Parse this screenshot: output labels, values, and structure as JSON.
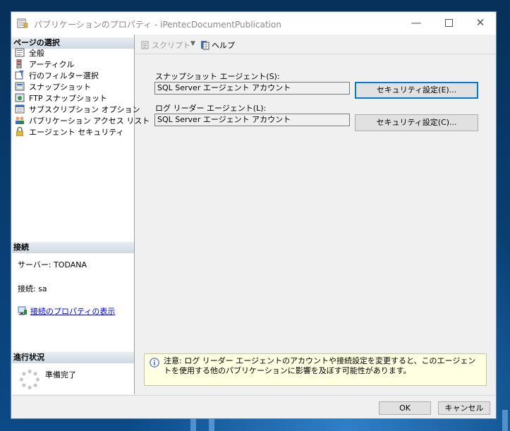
{
  "window": {
    "title": "パブリケーションのプロパティ - iPentecDocumentPublication",
    "minimize_icon": "minimize-icon",
    "maximize_icon": "maximize-icon",
    "close_glyph": "✕"
  },
  "left": {
    "select_page_header": "ページの選択",
    "pages": [
      {
        "label": "全般",
        "icon": "general-page-icon"
      },
      {
        "label": "アーティクル",
        "icon": "articles-page-icon"
      },
      {
        "label": "行のフィルター選択",
        "icon": "filter-rows-page-icon"
      },
      {
        "label": "スナップショット",
        "icon": "snapshot-page-icon"
      },
      {
        "label": "FTP スナップショット",
        "icon": "ftp-snapshot-page-icon"
      },
      {
        "label": "サブスクリプション オプション",
        "icon": "subscription-options-page-icon"
      },
      {
        "label": "パブリケーション アクセス リスト",
        "icon": "access-list-page-icon"
      },
      {
        "label": "エージェント セキュリティ",
        "icon": "agent-security-page-icon"
      }
    ],
    "connection_header": "接続",
    "server_text": "サーバー: TODANA",
    "connection_text": "接続: sa",
    "view_connection_link": "接続のプロパティの表示",
    "progress_header": "進行状況",
    "progress_status": "準備完了"
  },
  "toolbar": {
    "script_label": "スクリプト",
    "help_label": "ヘルプ"
  },
  "main": {
    "snapshot_agent_label": "スナップショット エージェント(S):",
    "snapshot_agent_value": "SQL Server エージェント アカウント",
    "snapshot_security_button": "セキュリティ設定(E)...",
    "log_reader_label": "ログ リーダー エージェント(L):",
    "log_reader_value": "SQL Server エージェント アカウント",
    "log_reader_security_button": "セキュリティ設定(C)...",
    "notice_text": "注意: ログ リーダー エージェントのアカウントや接続設定を変更すると、このエージェントを使用する他のパブリケーションに影響を及ぼす可能性があります。"
  },
  "footer": {
    "ok_button": "OK",
    "cancel_button": "キャンセル"
  },
  "colors": {
    "accent": "#0078d7",
    "notice_bg": "#ffffe1",
    "link": "#0000ee"
  }
}
